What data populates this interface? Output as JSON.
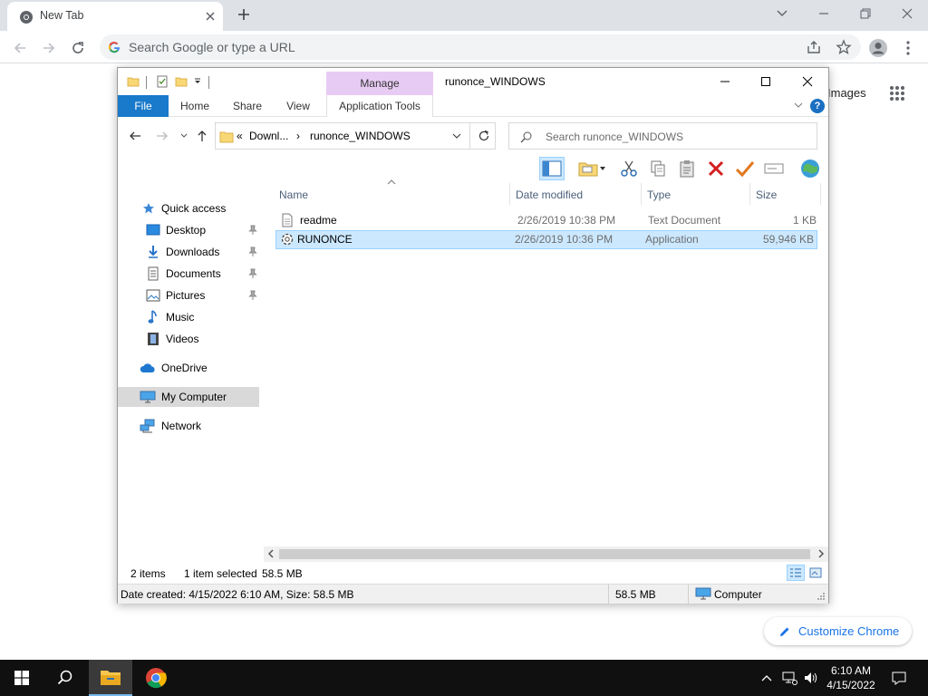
{
  "chrome": {
    "tab_title": "New Tab",
    "omnibox_placeholder": "Search Google or type a URL",
    "ntp_images": "Images",
    "customize_label": "Customize Chrome"
  },
  "explorer": {
    "title": "runonce_WINDOWS",
    "context_tab_group": "Manage",
    "ribbon_tabs": [
      "File",
      "Home",
      "Share",
      "View",
      "Application Tools"
    ],
    "help": "?",
    "address": {
      "overflow": "«",
      "crumb_1": "Downl...",
      "separator": "›",
      "crumb_2": "runonce_WINDOWS"
    },
    "search_placeholder": "Search runonce_WINDOWS",
    "nav": {
      "quick_access": "Quick access",
      "desktop": "Desktop",
      "downloads": "Downloads",
      "documents": "Documents",
      "pictures": "Pictures",
      "music": "Music",
      "videos": "Videos",
      "onedrive": "OneDrive",
      "my_computer": "My Computer",
      "network": "Network"
    },
    "columns": {
      "name": "Name",
      "date": "Date modified",
      "type": "Type",
      "size": "Size"
    },
    "files": [
      {
        "name": "readme",
        "date": "2/26/2019 10:38 PM",
        "type": "Text Document",
        "size": "1 KB"
      },
      {
        "name": "RUNONCE",
        "date": "2/26/2019 10:36 PM",
        "type": "Application",
        "size": "59,946 KB"
      }
    ],
    "status": {
      "items": "2 items",
      "selected": "1 item selected",
      "selected_size": "58.5 MB"
    },
    "details": {
      "info": "Date created: 4/15/2022 6:10 AM, Size: 58.5 MB",
      "size": "58.5 MB",
      "location": "Computer"
    }
  },
  "taskbar": {
    "time": "6:10 AM",
    "date": "4/15/2022"
  },
  "colors": {
    "accent": "#1979ca",
    "selection": "#cce8ff",
    "manage_tab": "#e8cbf4",
    "chrome_link": "#1a73e8"
  }
}
